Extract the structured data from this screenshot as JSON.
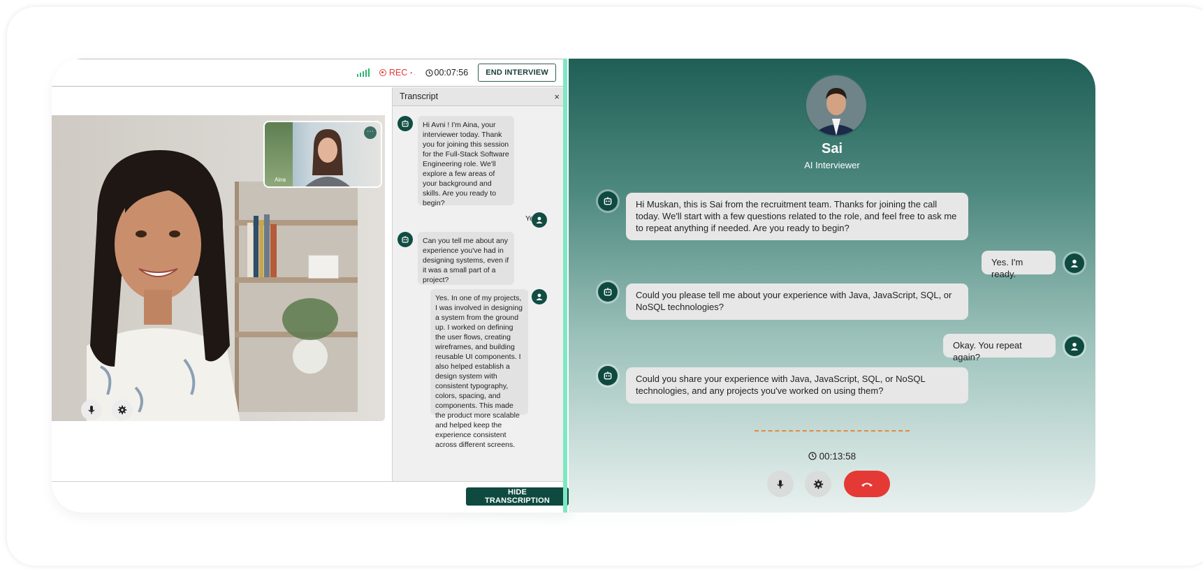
{
  "toolbar": {
    "rec_label": "REC",
    "timer": "00:07:56",
    "end_button": "END INTERVIEW"
  },
  "video": {
    "pip_name": "Aina"
  },
  "transcript": {
    "title": "Transcript",
    "close_icon": "×",
    "messages": [
      {
        "role": "ai",
        "text": "Hi Avni ! I'm Aina, your interviewer today. Thank you for joining this session for the Full-Stack Software Engineering role. We'll explore a few areas of your background and skills. Are you ready to begin?"
      },
      {
        "role": "user",
        "text": "Yes."
      },
      {
        "role": "ai",
        "text": "Can you tell me about any experience you've had in designing systems, even if it was a small part of a project?"
      },
      {
        "role": "user",
        "text": "Yes. In one of my projects, I was involved in designing a system from the ground up. I worked on defining the user flows, creating wireframes, and building reusable UI components. I also helped establish a design system with consistent typography, colors, spacing, and components. This made the product more scalable and helped keep the experience consistent across different screens."
      }
    ]
  },
  "hide_button": "HIDE TRANSCRIPTION",
  "agent": {
    "name": "Sai",
    "role": "AI Interviewer"
  },
  "chat": [
    {
      "role": "ai",
      "text": "Hi Muskan, this is Sai from the recruitment team. Thanks for joining the call today. We'll start with a few questions related to the role, and feel free to ask me to repeat anything if needed. Are you ready to begin?"
    },
    {
      "role": "user",
      "text": "Yes. I'm ready."
    },
    {
      "role": "ai",
      "text": "Could you please tell me about your experience with Java, JavaScript, SQL, or NoSQL technologies?"
    },
    {
      "role": "user",
      "text": "Okay. You repeat again?"
    },
    {
      "role": "ai",
      "text": "Could you share your experience with Java, JavaScript, SQL, or NoSQL technologies, and any projects you've worked on using them?"
    }
  ],
  "call_timer": "00:13:58",
  "colors": {
    "brand_dark": "#0e4a40",
    "accent_green": "#7ee8c3",
    "rec_red": "#e53935",
    "hangup_red": "#e53935"
  }
}
